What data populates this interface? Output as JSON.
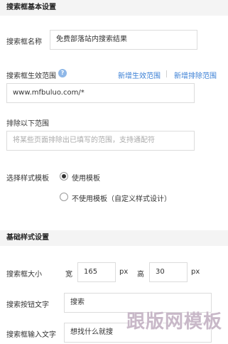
{
  "section_basic": {
    "title": "搜索框基本设置"
  },
  "search_name": {
    "label": "搜索框名称",
    "value": "免费部落站内搜索结果"
  },
  "search_scope": {
    "label": "搜索框生效范围",
    "add_scope": "新增生效范围",
    "add_exclude": "新增排除范围",
    "value": "www.mfbuluo.com/*"
  },
  "exclude_scope": {
    "label": "排除以下范围",
    "placeholder": "将某些页面排除出已填写的范围，支持通配符"
  },
  "template": {
    "label": "选择样式模板",
    "option_use": "使用模板",
    "option_custom": "不使用模板（自定义样式设计）",
    "selected": "使用模板"
  },
  "section_style": {
    "title": "基础样式设置"
  },
  "size": {
    "label": "搜索框大小",
    "width_label": "宽",
    "width_value": "165",
    "width_unit": "px",
    "height_label": "高",
    "height_value": "30",
    "height_unit": "px"
  },
  "button_text": {
    "label": "搜索按钮文字",
    "value": "搜索"
  },
  "input_text": {
    "label": "搜索框输入文字",
    "value": "想找什么就搜"
  },
  "watermark": {
    "text": "跟版网模板"
  }
}
